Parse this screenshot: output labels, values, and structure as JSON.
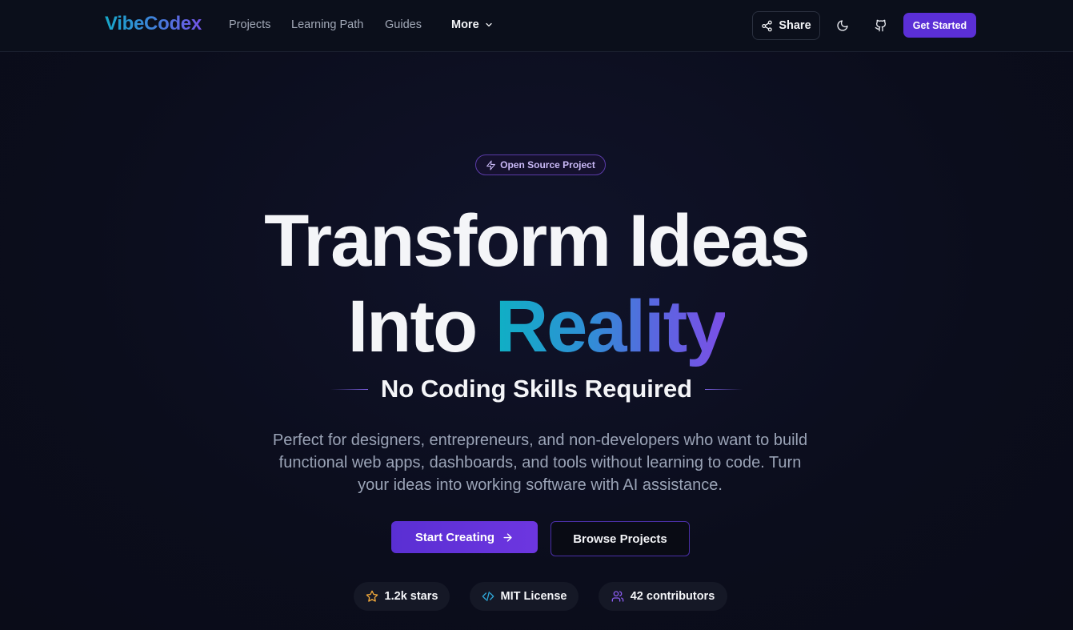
{
  "navbar": {
    "logo": "VibeCodex",
    "links": [
      "Projects",
      "Learning Path",
      "Guides"
    ],
    "more_label": "More",
    "share_label": "Share",
    "get_started_label": "Get Started"
  },
  "hero": {
    "badge": "Open Source Project",
    "headline_line1": "Transform Ideas",
    "headline_line2_plain": "Into ",
    "headline_line2_accent": "Reality",
    "subheadline": "No Coding Skills Required",
    "description": "Perfect for designers, entrepreneurs, and non-developers who want to build functional web apps, dashboards, and tools without learning to code. Turn your ideas into working software with AI assistance.",
    "primary_cta": "Start Creating",
    "secondary_cta": "Browse Projects"
  },
  "stats": [
    {
      "icon": "star-icon",
      "label": "1.2k stars"
    },
    {
      "icon": "code-icon",
      "label": "MIT License"
    },
    {
      "icon": "users-icon",
      "label": "42 contributors"
    }
  ],
  "colors": {
    "accent": "#5b2fd6",
    "background": "#0b0d1c",
    "gradient_start": "#16a8c9",
    "gradient_end": "#7b4fe6"
  }
}
